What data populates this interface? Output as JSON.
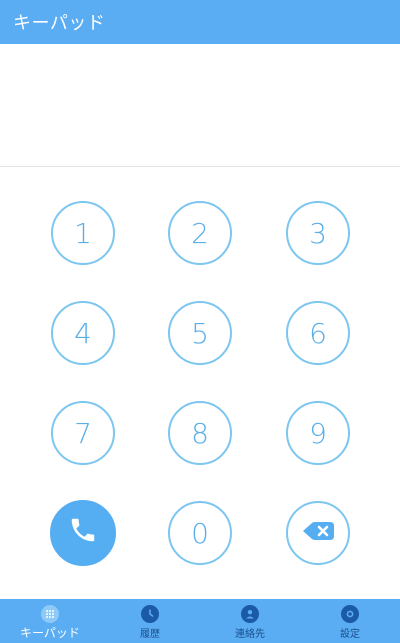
{
  "app_bar": {
    "title": "キーパッド"
  },
  "keypad": {
    "keys": [
      "1",
      "2",
      "3",
      "4",
      "5",
      "6",
      "7",
      "8",
      "9",
      "0"
    ]
  },
  "actions": {
    "call_icon": "phone-icon",
    "delete_icon": "backspace-icon"
  },
  "bottom_nav": {
    "items": [
      {
        "label": "キーパッド",
        "icon": "dialpad-icon",
        "active": true
      },
      {
        "label": "履歴",
        "icon": "clock-icon",
        "active": false
      },
      {
        "label": "連絡先",
        "icon": "person-icon",
        "active": false
      },
      {
        "label": "設定",
        "icon": "settings-icon",
        "active": false
      }
    ]
  },
  "colors": {
    "primary": "#5aacf3",
    "key_border": "#7cc6f0",
    "key_text": "#5aaee8",
    "nav_inactive": "#1a4f8c"
  }
}
